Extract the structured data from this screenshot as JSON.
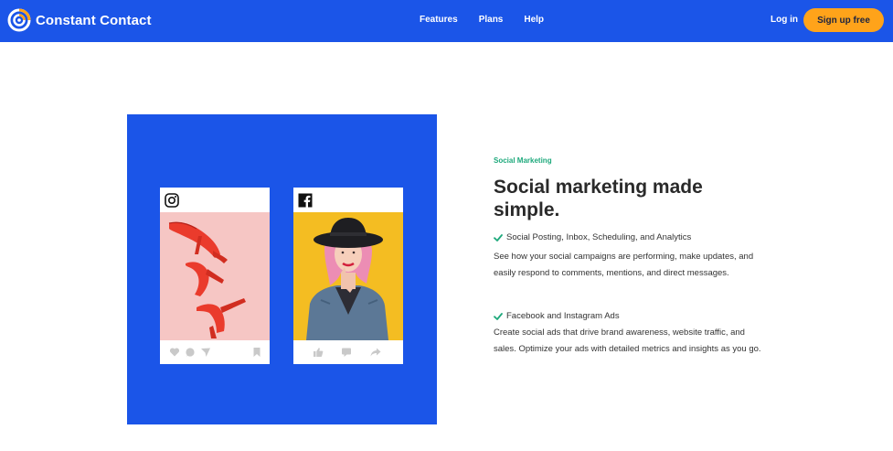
{
  "nav": {
    "brand": "Constant Contact",
    "links": [
      "Features",
      "Plans",
      "Help"
    ],
    "login": "Log in",
    "signup": "Sign up free"
  },
  "hero": {
    "cards": [
      {
        "network": "Instagram",
        "icon": "instagram-icon",
        "photo": "red high-heel shoes on pink background",
        "actions": [
          "heart-icon",
          "comment-icon",
          "send-icon",
          "bookmark-icon"
        ]
      },
      {
        "network": "Facebook",
        "icon": "facebook-icon",
        "photo": "woman in black hat and denim vest on yellow background",
        "actions": [
          "like-icon",
          "comment-icon",
          "share-icon"
        ]
      }
    ]
  },
  "section": {
    "eyebrow": "Social Marketing",
    "headline": "Social marketing made simple.",
    "features": [
      {
        "title": "Social Posting, Inbox, Scheduling, and Analytics",
        "body": "See how your social campaigns are performing, make updates, and easily respond to comments, mentions, and direct messages."
      },
      {
        "title": "Facebook and Instagram Ads",
        "body": "Create social ads that drive brand awareness, website traffic, and sales. Optimize your ads with detailed metrics and insights as you go."
      }
    ]
  },
  "colors": {
    "brand_blue": "#1b55e8",
    "signup_orange": "#ffa31a",
    "eyebrow_green": "#1ea97c",
    "check_green": "#1ea97c",
    "text_dark": "#2a2a2a"
  }
}
